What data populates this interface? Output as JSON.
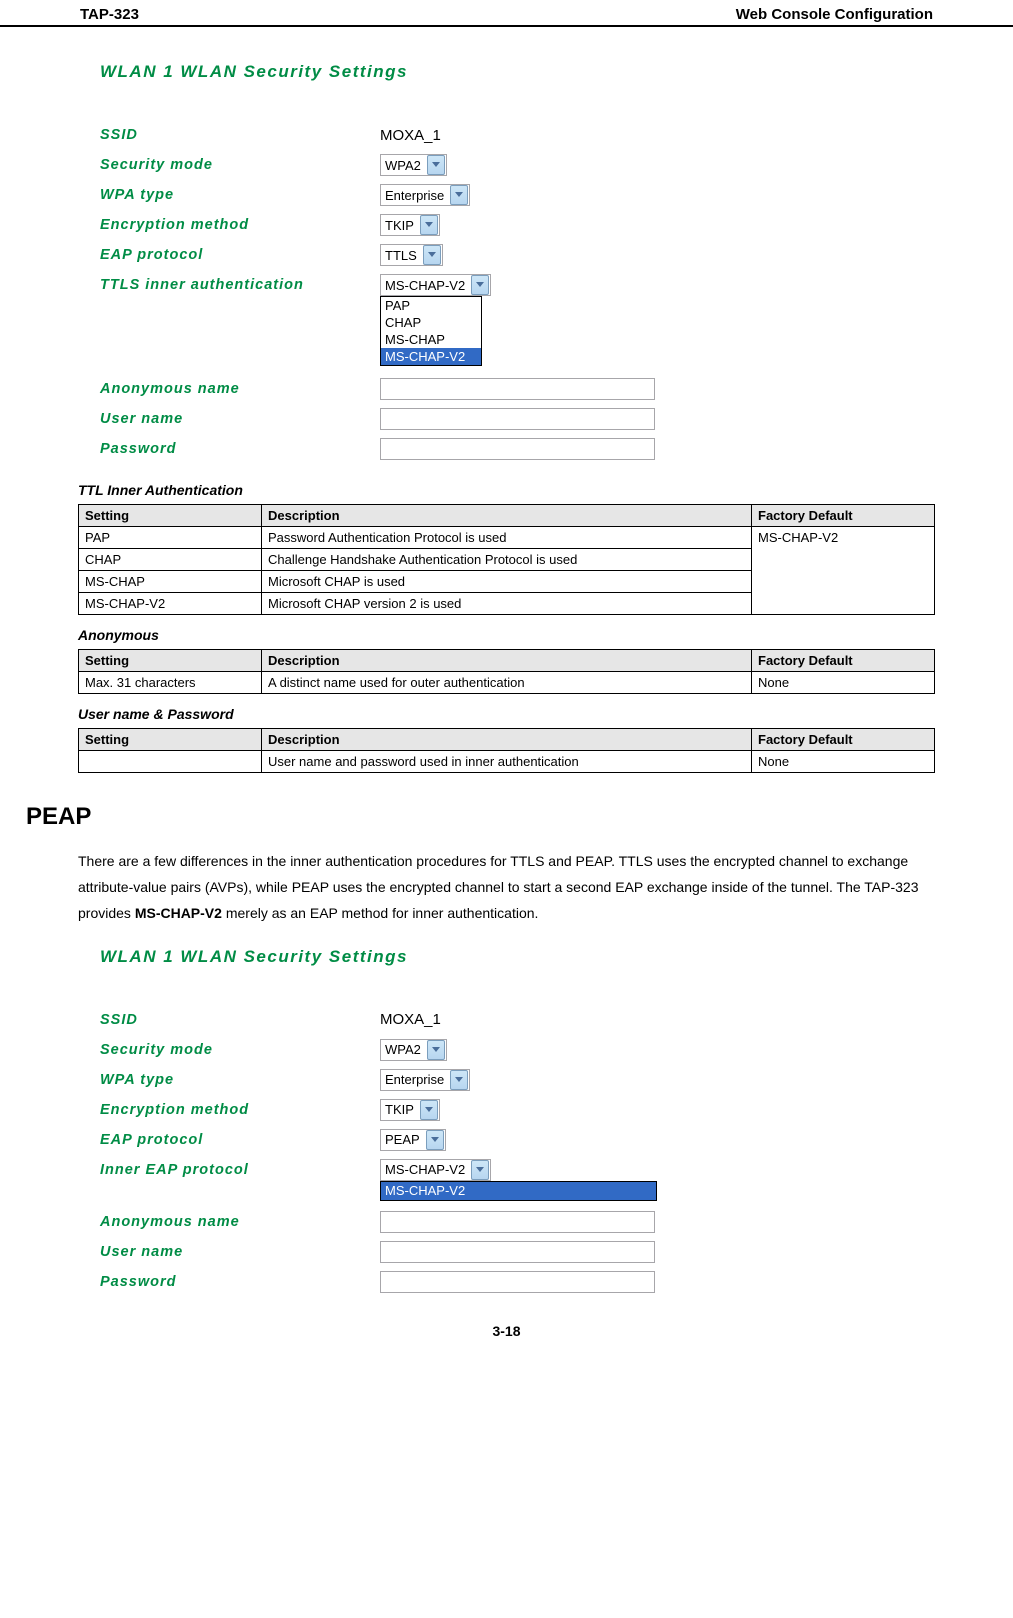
{
  "header": {
    "left": "TAP-323",
    "right": "Web Console Configuration"
  },
  "panel1": {
    "title": "WLAN 1  WLAN Security Settings",
    "ssid_label": "SSID",
    "ssid_value": "MOXA_1",
    "secmode_label": "Security mode",
    "secmode_value": "WPA2",
    "wpatype_label": "WPA type",
    "wpatype_value": "Enterprise",
    "enc_label": "Encryption method",
    "enc_value": "TKIP",
    "eap_label": "EAP protocol",
    "eap_value": "TTLS",
    "ttls_label": "TTLS inner authentication",
    "ttls_value": "MS-CHAP-V2",
    "ttls_options": [
      "PAP",
      "CHAP",
      "MS-CHAP",
      "MS-CHAP-V2"
    ],
    "anon_label": "Anonymous name",
    "user_label": "User name",
    "pass_label": "Password"
  },
  "tables": {
    "ttl": {
      "caption": "TTL Inner Authentication",
      "h1": "Setting",
      "h2": "Description",
      "h3": "Factory Default",
      "r1s": "PAP",
      "r1d": "Password Authentication Protocol is used",
      "r2s": "CHAP",
      "r2d": "Challenge Handshake Authentication Protocol is used",
      "r3s": "MS-CHAP",
      "r3d": "Microsoft CHAP is used",
      "r4s": "MS-CHAP-V2",
      "r4d": "Microsoft CHAP version 2 is used",
      "def": "MS-CHAP-V2"
    },
    "anon": {
      "caption": "Anonymous",
      "h1": "Setting",
      "h2": "Description",
      "h3": "Factory Default",
      "r1s": "Max. 31 characters",
      "r1d": "A distinct name used for outer authentication",
      "r1f": "None"
    },
    "user": {
      "caption": "User name & Password",
      "h1": "Setting",
      "h2": "Description",
      "h3": "Factory Default",
      "r1s": "",
      "r1d": "User name and password used in inner authentication",
      "r1f": "None"
    }
  },
  "peap": {
    "heading": "PEAP",
    "para_a": "There are a few differences in the inner authentication procedures for TTLS and PEAP. TTLS uses the encrypted channel to exchange attribute-value pairs (AVPs), while PEAP uses the encrypted channel to start a second EAP exchange inside of the tunnel. The TAP-323 provides ",
    "para_b": "MS-CHAP-V2",
    "para_c": " merely as an EAP method for inner authentication."
  },
  "panel2": {
    "title": "WLAN 1  WLAN Security Settings",
    "ssid_label": "SSID",
    "ssid_value": "MOXA_1",
    "secmode_label": "Security mode",
    "secmode_value": "WPA2",
    "wpatype_label": "WPA type",
    "wpatype_value": "Enterprise",
    "enc_label": "Encryption method",
    "enc_value": "TKIP",
    "eap_label": "EAP protocol",
    "eap_value": "PEAP",
    "inner_label": "Inner EAP protocol",
    "inner_value": "MS-CHAP-V2",
    "inner_options": [
      "MS-CHAP-V2"
    ],
    "anon_label": "Anonymous name",
    "user_label": "User name",
    "pass_label": "Password"
  },
  "page_number": "3-18"
}
